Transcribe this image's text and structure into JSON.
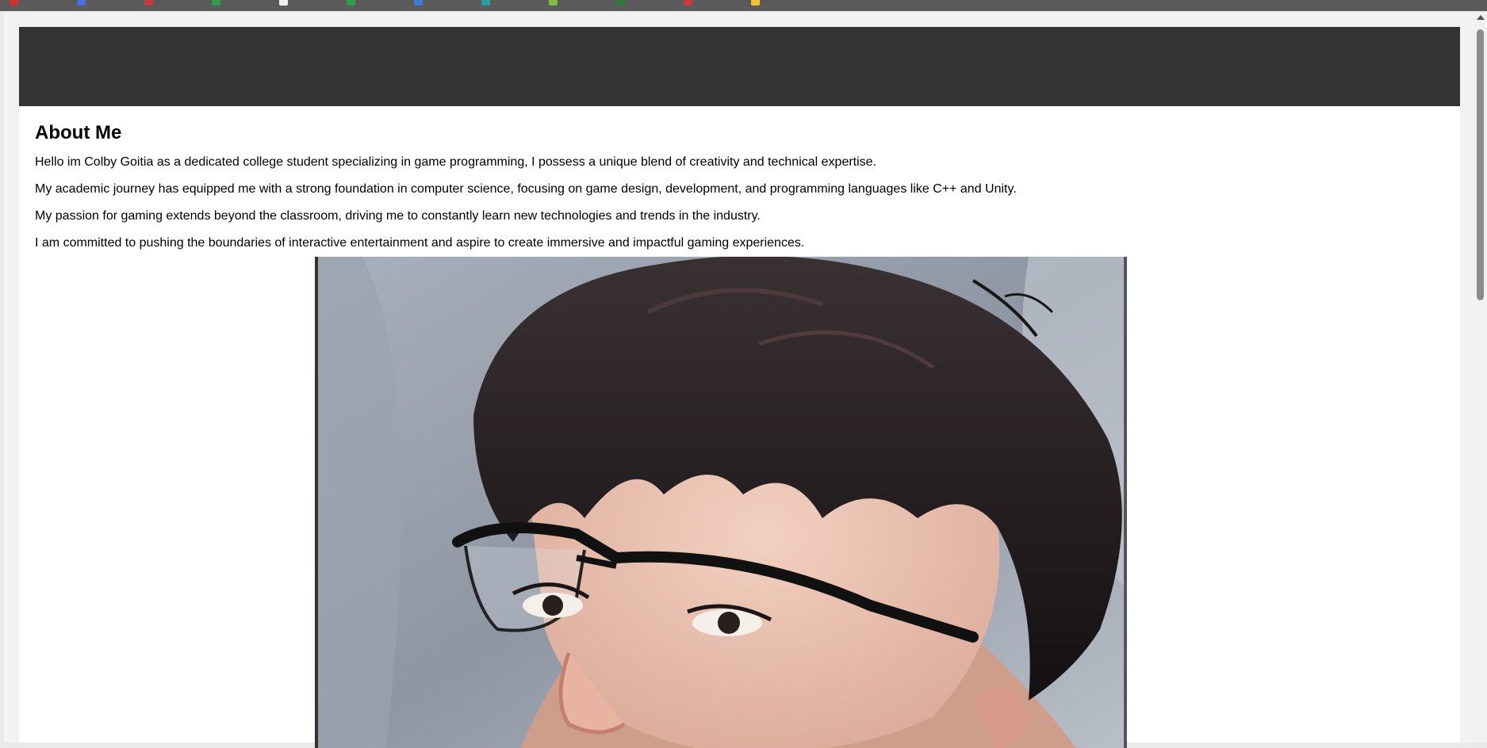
{
  "browser": {
    "bookmark_colors": [
      "#d03030",
      "#4a6ee0",
      "#c83c3c",
      "#2e9d4e",
      "#eeeeee",
      "#2e9d4e",
      "#3a7bd5",
      "#28a0a0",
      "#7fbf3f",
      "#2d7a3d",
      "#c83c3c",
      "#f2c230"
    ]
  },
  "header": {
    "background": "#333333"
  },
  "about": {
    "title": "About Me",
    "paragraphs": [
      "Hello im Colby Goitia as a dedicated college student specializing in game programming, I possess a unique blend of creativity and technical expertise.",
      "My academic journey has equipped me with a strong foundation in computer science, focusing on game design, development, and programming languages like C++ and Unity.",
      "My passion for gaming extends beyond the classroom, driving me to constantly learn new technologies and trends in the industry.",
      "I am committed to pushing the boundaries of interactive entertainment and aspire to create immersive and impactful gaming experiences."
    ]
  },
  "portrait": {
    "subject": "illustrated-portrait"
  }
}
